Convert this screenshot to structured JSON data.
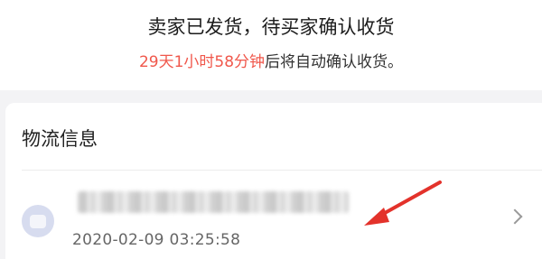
{
  "status": {
    "title": "卖家已发货，待买家确认收货",
    "countdown": "29天1小时58分钟",
    "countdown_suffix": "后将自动确认收货。"
  },
  "logistics": {
    "section_title": "物流信息",
    "timestamp": "2020-02-09 03:25:58",
    "icons": {
      "avatar": "package-icon",
      "chevron": "chevron-right-icon"
    }
  },
  "colors": {
    "accent": "#f0574b",
    "arrow": "#e3322b",
    "background": "#f3f3f5"
  }
}
